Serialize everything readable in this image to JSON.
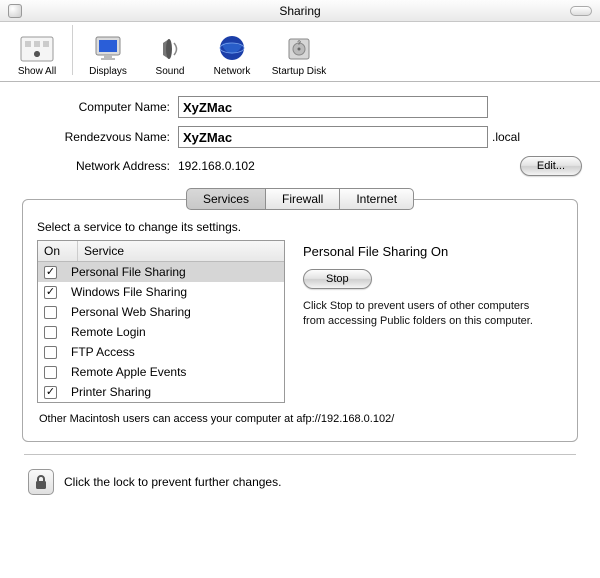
{
  "window": {
    "title": "Sharing"
  },
  "toolbar": {
    "show_all": "Show All",
    "displays": "Displays",
    "sound": "Sound",
    "network": "Network",
    "startup_disk": "Startup Disk"
  },
  "form": {
    "computer_name_label": "Computer Name:",
    "computer_name_value": "XyZMac",
    "rendezvous_name_label": "Rendezvous Name:",
    "rendezvous_name_value": "XyZMac",
    "rendezvous_suffix": ".local",
    "network_address_label": "Network Address:",
    "network_address_value": "192.168.0.102",
    "edit_button": "Edit..."
  },
  "tabs": {
    "services": "Services",
    "firewall": "Firewall",
    "internet": "Internet",
    "active": "services"
  },
  "services_panel": {
    "prompt": "Select a service to change its settings.",
    "col_on": "On",
    "col_service": "Service",
    "items": [
      {
        "label": "Personal File Sharing",
        "on": true,
        "selected": true
      },
      {
        "label": "Windows File Sharing",
        "on": true,
        "selected": false
      },
      {
        "label": "Personal Web Sharing",
        "on": false,
        "selected": false
      },
      {
        "label": "Remote Login",
        "on": false,
        "selected": false
      },
      {
        "label": "FTP Access",
        "on": false,
        "selected": false
      },
      {
        "label": "Remote Apple Events",
        "on": false,
        "selected": false
      },
      {
        "label": "Printer Sharing",
        "on": true,
        "selected": false
      }
    ],
    "detail_title": "Personal File Sharing On",
    "stop_button": "Stop",
    "help_text": "Click Stop to prevent users of other computers from accessing Public folders on this computer.",
    "footer": "Other Macintosh users can access your computer at afp://192.168.0.102/"
  },
  "lock_text": "Click the lock to prevent further changes."
}
